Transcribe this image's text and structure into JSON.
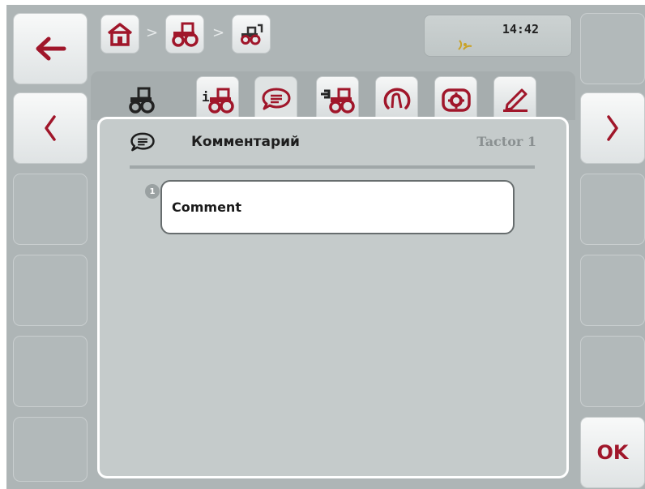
{
  "breadcrumb": [
    {
      "icon": "home-icon"
    },
    {
      "icon": "tractor-icon"
    },
    {
      "icon": "tractor-hitch-icon"
    }
  ],
  "breadcrumb_separator": ">",
  "status": {
    "time": "14:42",
    "signal_icon": "gps-signal-icon"
  },
  "tabs": [
    {
      "icon": "tractor-icon",
      "name": "tab-tractor"
    },
    {
      "icon": "info-tractor-icon",
      "name": "tab-info"
    },
    {
      "icon": "speech-bubble-icon",
      "name": "tab-comment",
      "active": true
    },
    {
      "icon": "connector-tractor-icon",
      "name": "tab-connector"
    },
    {
      "icon": "speed-sensor-icon",
      "name": "tab-speed"
    },
    {
      "icon": "settings-icon",
      "name": "tab-settings"
    },
    {
      "icon": "edit-pencil-icon",
      "name": "tab-edit"
    }
  ],
  "header": {
    "title": "Комментарий",
    "item_name": "Tactor 1"
  },
  "fields": [
    {
      "index": "1",
      "label": "Comment"
    }
  ],
  "buttons": {
    "back_icon": "arrow-left-icon",
    "prev_icon": "chevron-left-icon",
    "next_icon": "chevron-right-icon",
    "ok_label": "OK"
  },
  "colors": {
    "accent": "#a0162a",
    "panel": "#aeb5b6",
    "content": "#c5cbcb"
  }
}
